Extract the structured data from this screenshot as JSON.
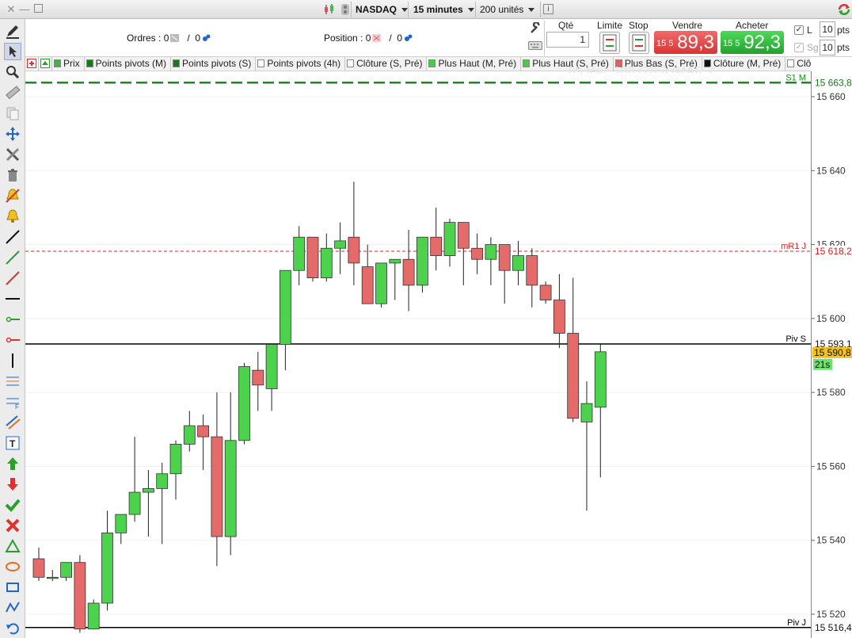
{
  "titlebar": {
    "instrument": "NASDAQ",
    "timeframe": "15 minutes",
    "units": "200 unités",
    "info_icon": "i"
  },
  "orders": {
    "orders_label": "Ordres :",
    "orders_count": "0",
    "orders_sep": "/",
    "orders_pending": "0",
    "position_label": "Position :",
    "position_count": "0",
    "position_sep": "/",
    "position_pending": "0"
  },
  "trade": {
    "qty_label": "Qté",
    "qty_value": "1",
    "limit_label": "Limite",
    "stop_label": "Stop",
    "sell_label": "Vendre",
    "buy_label": "Acheter",
    "sell_small": "15 5",
    "sell_big": "89,3",
    "buy_small": "15 5",
    "buy_big": "92,3",
    "l_label": "L",
    "sg_label": "Sg",
    "l_pts": "10",
    "sg_pts": "10",
    "pts_label": "pts",
    "pts_label2": "pts"
  },
  "legend": [
    {
      "label": "Prix",
      "color": "#3cb44b"
    },
    {
      "label": "Points pivots (M)",
      "color": "#1a7a1a"
    },
    {
      "label": "Points pivots (S)",
      "color": "#1a7a1a"
    },
    {
      "label": "Points pivots (4h)",
      "color": "#ffffff"
    },
    {
      "label": "Clôture (S, Pré)",
      "color": "#ffffff"
    },
    {
      "label": "Plus Haut (M, Pré)",
      "color": "#44cc44"
    },
    {
      "label": "Plus Haut (S, Pré)",
      "color": "#44cc44"
    },
    {
      "label": "Plus Bas (S, Pré)",
      "color": "#e06060"
    },
    {
      "label": "Clôture (M, Pré)",
      "color": "#111111"
    },
    {
      "label": "Clôtu",
      "color": "#ffffff"
    }
  ],
  "watermark": "09 févr. 100 (265) (MAR 2",
  "lines": {
    "s1m": {
      "label": "S1 M",
      "value": "15 663,8",
      "price": 15663.8,
      "color": "#1a8a1a"
    },
    "mr1j": {
      "label": "mR1 J",
      "value": "15 618,2",
      "price": 15618.2,
      "color": "#e02020"
    },
    "pivs": {
      "label": "Piv S",
      "value": "15 593,1",
      "price": 15593.1,
      "color": "#000000"
    },
    "pivj": {
      "label": "Piv J",
      "value": "15 516,4",
      "price": 15516.4,
      "color": "#000000"
    }
  },
  "current": {
    "value": "15 590,8",
    "countdown": "21s"
  },
  "axis_ticks": [
    "15 660",
    "15 640",
    "15 620",
    "15 600",
    "15 580",
    "15 560",
    "15 540",
    "15 520"
  ],
  "chart_data": {
    "type": "candlestick",
    "ylim": [
      15515,
      15667
    ],
    "up_color": "#4cd24c",
    "down_color": "#e56a6a",
    "candles": [
      {
        "o": 15535,
        "h": 15538,
        "l": 15529,
        "c": 15530
      },
      {
        "o": 15530,
        "h": 15532,
        "l": 15529,
        "c": 15530
      },
      {
        "o": 15530,
        "h": 15534,
        "l": 15529,
        "c": 15534
      },
      {
        "o": 15534,
        "h": 15536,
        "l": 15515,
        "c": 15516
      },
      {
        "o": 15516,
        "h": 15524,
        "l": 15516,
        "c": 15523
      },
      {
        "o": 15523,
        "h": 15548,
        "l": 15521,
        "c": 15542
      },
      {
        "o": 15542,
        "h": 15545,
        "l": 15539,
        "c": 15547
      },
      {
        "o": 15547,
        "h": 15568,
        "l": 15545,
        "c": 15553
      },
      {
        "o": 15553,
        "h": 15559,
        "l": 15541,
        "c": 15554
      },
      {
        "o": 15554,
        "h": 15561,
        "l": 15539,
        "c": 15558
      },
      {
        "o": 15558,
        "h": 15567,
        "l": 15551,
        "c": 15566
      },
      {
        "o": 15566,
        "h": 15575,
        "l": 15564,
        "c": 15571
      },
      {
        "o": 15571,
        "h": 15574,
        "l": 15559,
        "c": 15568
      },
      {
        "o": 15568,
        "h": 15580,
        "l": 15533,
        "c": 15541
      },
      {
        "o": 15541,
        "h": 15580,
        "l": 15536,
        "c": 15567
      },
      {
        "o": 15567,
        "h": 15588,
        "l": 15566,
        "c": 15587
      },
      {
        "o": 15586,
        "h": 15591,
        "l": 15575,
        "c": 15582
      },
      {
        "o": 15581,
        "h": 15593,
        "l": 15575,
        "c": 15593
      },
      {
        "o": 15593,
        "h": 15599,
        "l": 15586,
        "c": 15613
      },
      {
        "o": 15613,
        "h": 15625,
        "l": 15609,
        "c": 15622
      },
      {
        "o": 15622,
        "h": 15622,
        "l": 15610,
        "c": 15611
      },
      {
        "o": 15611,
        "h": 15623,
        "l": 15610,
        "c": 15619
      },
      {
        "o": 15619,
        "h": 15626,
        "l": 15612,
        "c": 15621
      },
      {
        "o": 15622,
        "h": 15637,
        "l": 15609,
        "c": 15615
      },
      {
        "o": 15614,
        "h": 15620,
        "l": 15606,
        "c": 15604
      },
      {
        "o": 15604,
        "h": 15612,
        "l": 15603,
        "c": 15615
      },
      {
        "o": 15615,
        "h": 15614,
        "l": 15605,
        "c": 15616
      },
      {
        "o": 15616,
        "h": 15624,
        "l": 15602,
        "c": 15609
      },
      {
        "o": 15609,
        "h": 15620,
        "l": 15607,
        "c": 15622
      },
      {
        "o": 15622,
        "h": 15630,
        "l": 15613,
        "c": 15617
      },
      {
        "o": 15617,
        "h": 15627,
        "l": 15614,
        "c": 15626
      },
      {
        "o": 15626,
        "h": 15626,
        "l": 15609,
        "c": 15619
      },
      {
        "o": 15619,
        "h": 15623,
        "l": 15612,
        "c": 15616
      },
      {
        "o": 15616,
        "h": 15622,
        "l": 15609,
        "c": 15620
      },
      {
        "o": 15620,
        "h": 15618,
        "l": 15604,
        "c": 15613
      },
      {
        "o": 15613,
        "h": 15621,
        "l": 15609,
        "c": 15617
      },
      {
        "o": 15617,
        "h": 15619,
        "l": 15603,
        "c": 15609
      },
      {
        "o": 15609,
        "h": 15610,
        "l": 15604,
        "c": 15605
      },
      {
        "o": 15605,
        "h": 15612,
        "l": 15592,
        "c": 15596
      },
      {
        "o": 15596,
        "h": 15611,
        "l": 15572,
        "c": 15573
      },
      {
        "o": 15572,
        "h": 15583,
        "l": 15548,
        "c": 15577
      },
      {
        "o": 15576,
        "h": 15593,
        "l": 15557,
        "c": 15591
      }
    ]
  }
}
